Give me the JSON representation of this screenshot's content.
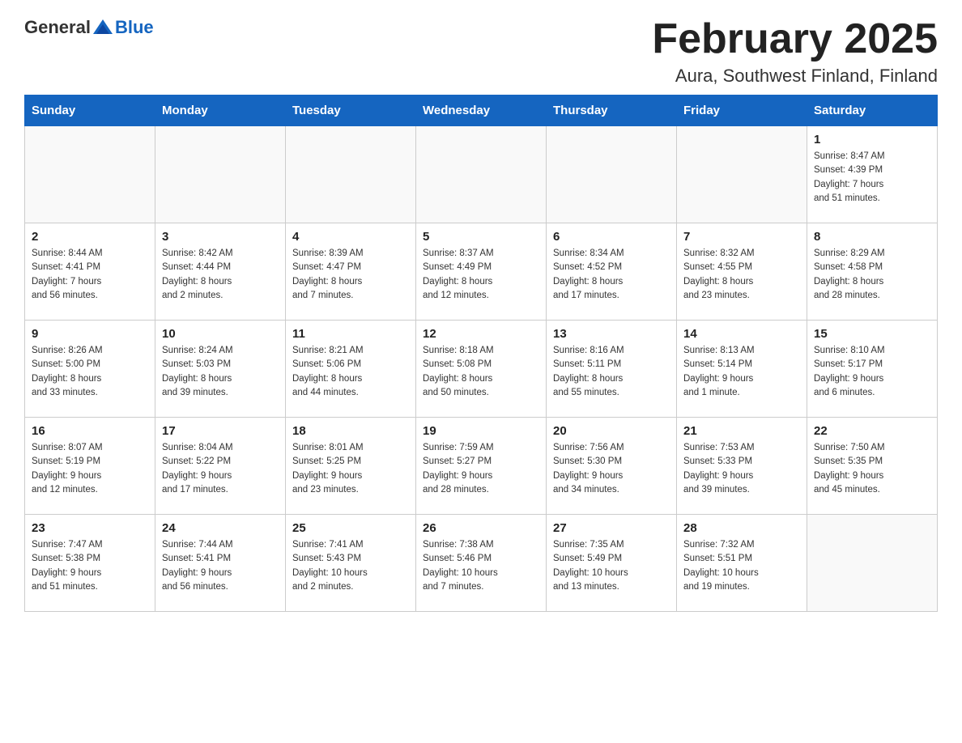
{
  "header": {
    "logo_general": "General",
    "logo_blue": "Blue",
    "title": "February 2025",
    "subtitle": "Aura, Southwest Finland, Finland"
  },
  "days_of_week": [
    "Sunday",
    "Monday",
    "Tuesday",
    "Wednesday",
    "Thursday",
    "Friday",
    "Saturday"
  ],
  "weeks": [
    [
      {
        "day": "",
        "info": ""
      },
      {
        "day": "",
        "info": ""
      },
      {
        "day": "",
        "info": ""
      },
      {
        "day": "",
        "info": ""
      },
      {
        "day": "",
        "info": ""
      },
      {
        "day": "",
        "info": ""
      },
      {
        "day": "1",
        "info": "Sunrise: 8:47 AM\nSunset: 4:39 PM\nDaylight: 7 hours\nand 51 minutes."
      }
    ],
    [
      {
        "day": "2",
        "info": "Sunrise: 8:44 AM\nSunset: 4:41 PM\nDaylight: 7 hours\nand 56 minutes."
      },
      {
        "day": "3",
        "info": "Sunrise: 8:42 AM\nSunset: 4:44 PM\nDaylight: 8 hours\nand 2 minutes."
      },
      {
        "day": "4",
        "info": "Sunrise: 8:39 AM\nSunset: 4:47 PM\nDaylight: 8 hours\nand 7 minutes."
      },
      {
        "day": "5",
        "info": "Sunrise: 8:37 AM\nSunset: 4:49 PM\nDaylight: 8 hours\nand 12 minutes."
      },
      {
        "day": "6",
        "info": "Sunrise: 8:34 AM\nSunset: 4:52 PM\nDaylight: 8 hours\nand 17 minutes."
      },
      {
        "day": "7",
        "info": "Sunrise: 8:32 AM\nSunset: 4:55 PM\nDaylight: 8 hours\nand 23 minutes."
      },
      {
        "day": "8",
        "info": "Sunrise: 8:29 AM\nSunset: 4:58 PM\nDaylight: 8 hours\nand 28 minutes."
      }
    ],
    [
      {
        "day": "9",
        "info": "Sunrise: 8:26 AM\nSunset: 5:00 PM\nDaylight: 8 hours\nand 33 minutes."
      },
      {
        "day": "10",
        "info": "Sunrise: 8:24 AM\nSunset: 5:03 PM\nDaylight: 8 hours\nand 39 minutes."
      },
      {
        "day": "11",
        "info": "Sunrise: 8:21 AM\nSunset: 5:06 PM\nDaylight: 8 hours\nand 44 minutes."
      },
      {
        "day": "12",
        "info": "Sunrise: 8:18 AM\nSunset: 5:08 PM\nDaylight: 8 hours\nand 50 minutes."
      },
      {
        "day": "13",
        "info": "Sunrise: 8:16 AM\nSunset: 5:11 PM\nDaylight: 8 hours\nand 55 minutes."
      },
      {
        "day": "14",
        "info": "Sunrise: 8:13 AM\nSunset: 5:14 PM\nDaylight: 9 hours\nand 1 minute."
      },
      {
        "day": "15",
        "info": "Sunrise: 8:10 AM\nSunset: 5:17 PM\nDaylight: 9 hours\nand 6 minutes."
      }
    ],
    [
      {
        "day": "16",
        "info": "Sunrise: 8:07 AM\nSunset: 5:19 PM\nDaylight: 9 hours\nand 12 minutes."
      },
      {
        "day": "17",
        "info": "Sunrise: 8:04 AM\nSunset: 5:22 PM\nDaylight: 9 hours\nand 17 minutes."
      },
      {
        "day": "18",
        "info": "Sunrise: 8:01 AM\nSunset: 5:25 PM\nDaylight: 9 hours\nand 23 minutes."
      },
      {
        "day": "19",
        "info": "Sunrise: 7:59 AM\nSunset: 5:27 PM\nDaylight: 9 hours\nand 28 minutes."
      },
      {
        "day": "20",
        "info": "Sunrise: 7:56 AM\nSunset: 5:30 PM\nDaylight: 9 hours\nand 34 minutes."
      },
      {
        "day": "21",
        "info": "Sunrise: 7:53 AM\nSunset: 5:33 PM\nDaylight: 9 hours\nand 39 minutes."
      },
      {
        "day": "22",
        "info": "Sunrise: 7:50 AM\nSunset: 5:35 PM\nDaylight: 9 hours\nand 45 minutes."
      }
    ],
    [
      {
        "day": "23",
        "info": "Sunrise: 7:47 AM\nSunset: 5:38 PM\nDaylight: 9 hours\nand 51 minutes."
      },
      {
        "day": "24",
        "info": "Sunrise: 7:44 AM\nSunset: 5:41 PM\nDaylight: 9 hours\nand 56 minutes."
      },
      {
        "day": "25",
        "info": "Sunrise: 7:41 AM\nSunset: 5:43 PM\nDaylight: 10 hours\nand 2 minutes."
      },
      {
        "day": "26",
        "info": "Sunrise: 7:38 AM\nSunset: 5:46 PM\nDaylight: 10 hours\nand 7 minutes."
      },
      {
        "day": "27",
        "info": "Sunrise: 7:35 AM\nSunset: 5:49 PM\nDaylight: 10 hours\nand 13 minutes."
      },
      {
        "day": "28",
        "info": "Sunrise: 7:32 AM\nSunset: 5:51 PM\nDaylight: 10 hours\nand 19 minutes."
      },
      {
        "day": "",
        "info": ""
      }
    ]
  ]
}
